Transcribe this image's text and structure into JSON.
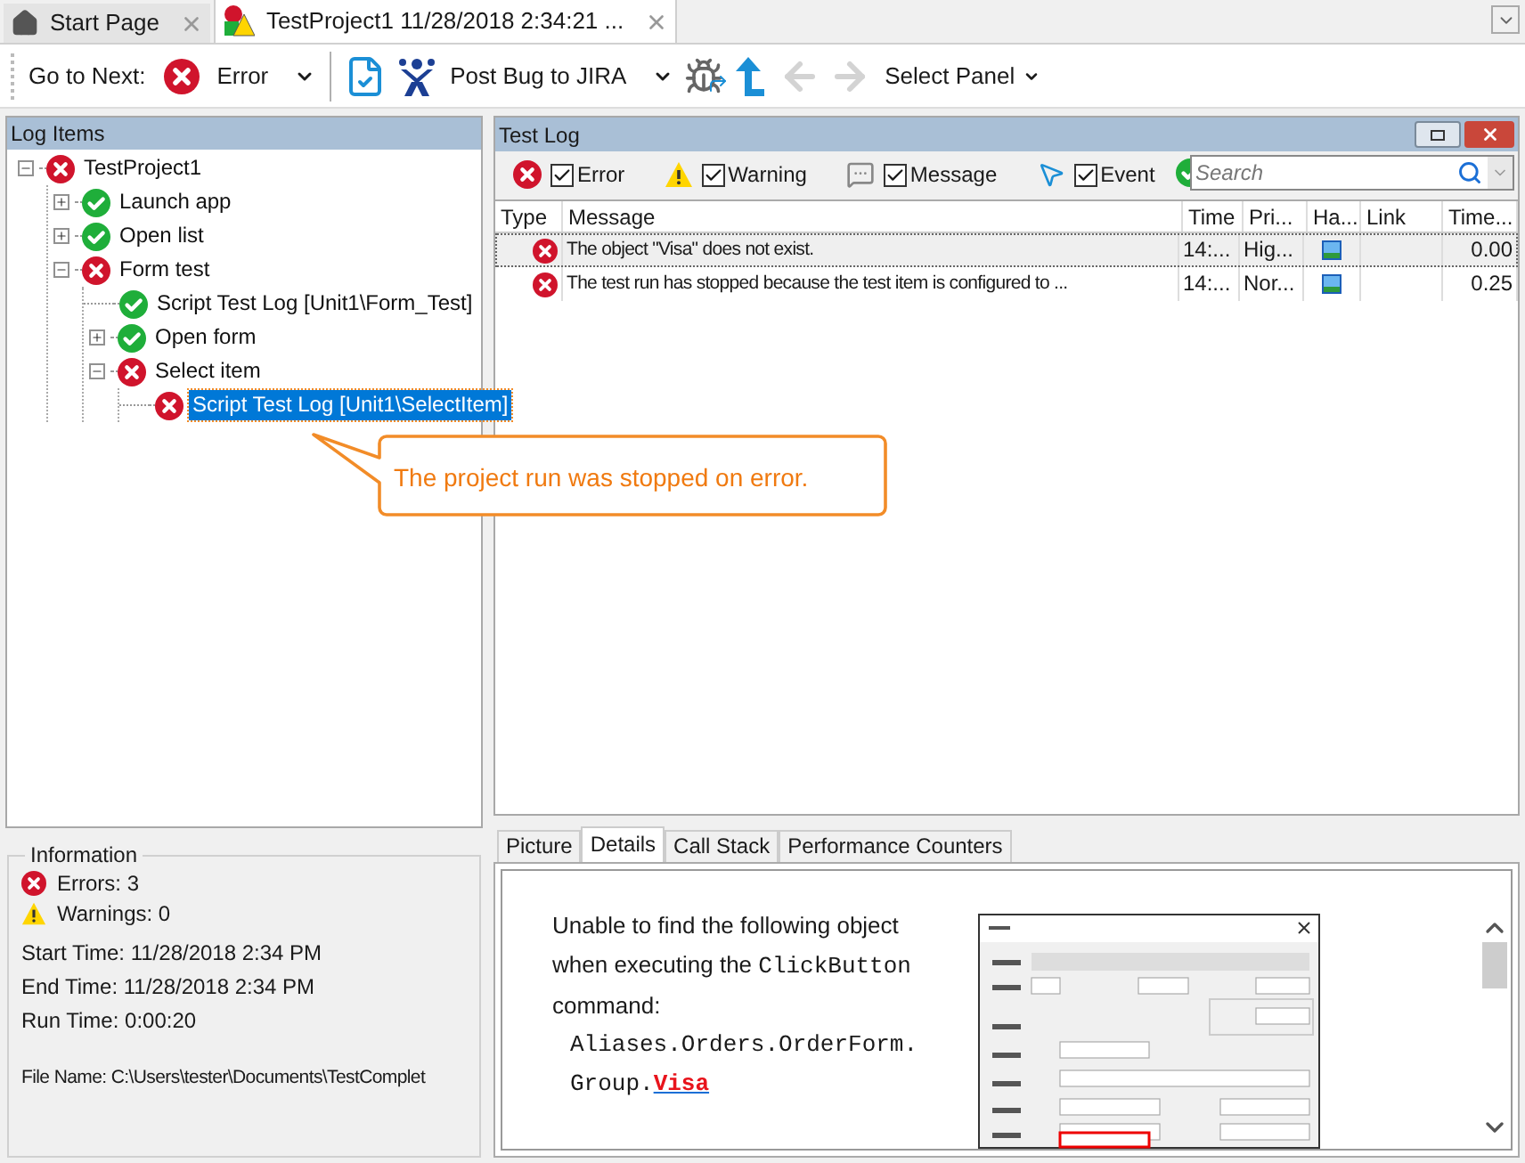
{
  "doc_tabs": [
    {
      "label": "Start Page",
      "kind": "home",
      "selected": false
    },
    {
      "label": "TestProject1 11/28/2018 2:34:21 ...",
      "kind": "log",
      "selected": true
    }
  ],
  "toolbar": {
    "goto_label": "Go to Next:",
    "items": [
      {
        "kind": "error-dropdown",
        "label": "Error",
        "disabled": false
      },
      {
        "kind": "separator"
      },
      {
        "kind": "doc-check",
        "disabled": false
      },
      {
        "kind": "jira",
        "label": "Post Bug to JIRA",
        "disabled": false
      },
      {
        "kind": "bug",
        "disabled": false
      },
      {
        "kind": "up",
        "disabled": false
      },
      {
        "kind": "back",
        "disabled": true
      },
      {
        "kind": "forward",
        "disabled": true
      },
      {
        "kind": "menu",
        "label": "Select Panel",
        "disabled": false
      }
    ]
  },
  "log_items": {
    "title": "Log Items",
    "tree": [
      {
        "label": "TestProject1",
        "kind": "error",
        "expanded": true,
        "selected": false,
        "children": [
          {
            "label": "Launch app",
            "kind": "passed",
            "expanded": false,
            "selected": false
          },
          {
            "label": "Open list",
            "kind": "passed",
            "expanded": false,
            "selected": false
          },
          {
            "label": "Form test",
            "kind": "error",
            "expanded": true,
            "selected": false,
            "children": [
              {
                "label": "Script Test Log [Unit1\\Form_Test]",
                "kind": "passed",
                "selected": false
              },
              {
                "label": "Open form",
                "kind": "passed",
                "expanded": false,
                "selected": false
              },
              {
                "label": "Select item",
                "kind": "error",
                "expanded": true,
                "selected": false,
                "children": [
                  {
                    "label": "Script Test Log [Unit1\\SelectItem]",
                    "kind": "error",
                    "selected": true
                  }
                ]
              }
            ]
          }
        ]
      }
    ]
  },
  "callout": "The project run was stopped on error.",
  "information": {
    "title": "Information",
    "errors": "Errors: 3",
    "warnings": "Warnings: 0",
    "lines": [
      "Start Time: 11/28/2018 2:34 PM",
      "End Time: 11/28/2018 2:34 PM",
      "Run Time: 0:00:20"
    ],
    "file": "File Name: C:\\Users\\tester\\Documents\\TestComplet"
  },
  "test_log": {
    "title": "Test Log",
    "filters": [
      {
        "kind": "error",
        "label": "Error",
        "checked": true
      },
      {
        "kind": "warning",
        "label": "Warning",
        "checked": true
      },
      {
        "kind": "message",
        "label": "Message",
        "checked": true
      },
      {
        "kind": "event",
        "label": "Event",
        "checked": true
      }
    ],
    "search": {
      "placeholder": "Search"
    },
    "columns": [
      "Type",
      "Message",
      "Time",
      "Pri...",
      "Ha...",
      "Link",
      "Time..."
    ],
    "rows": [
      {
        "kind": "error",
        "message": "The object \"Visa\" does not exist.",
        "time": "14:...",
        "priority": "Hig...",
        "has_picture": true,
        "duration": "0.00",
        "selected": true
      },
      {
        "kind": "error",
        "message": "The test run has stopped because the test item is configured to ...",
        "time": "14:...",
        "priority": "Nor...",
        "has_picture": true,
        "duration": "0.25",
        "selected": false
      }
    ]
  },
  "detail_tabs": [
    {
      "label": "Picture",
      "selected": false
    },
    {
      "label": "Details",
      "selected": true
    },
    {
      "label": "Call Stack",
      "selected": false
    },
    {
      "label": "Performance Counters",
      "selected": false
    }
  ],
  "details": {
    "intro": [
      {
        "kind": "plain",
        "text": "Unable to find the following object when executing the "
      },
      {
        "kind": "code",
        "text": "ClickButton"
      },
      {
        "kind": "plain",
        "text": " command:"
      }
    ],
    "path_lines": [
      "Aliases.Orders.OrderForm.",
      "Group."
    ],
    "link": "Visa"
  }
}
